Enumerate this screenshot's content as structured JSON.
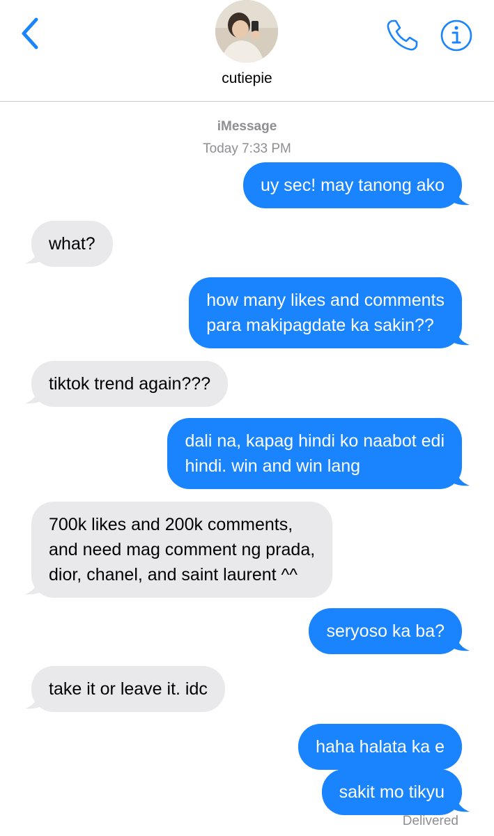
{
  "header": {
    "contact_name": "cutiepie"
  },
  "thread": {
    "service": "iMessage",
    "timestamp": "Today 7:33 PM",
    "messages": [
      {
        "direction": "outgoing",
        "text": "uy sec! may tanong ako"
      },
      {
        "direction": "incoming",
        "text": "what?"
      },
      {
        "direction": "outgoing",
        "text": "how many likes and comments\npara makipagdate  ka sakin??"
      },
      {
        "direction": "incoming",
        "text": "tiktok trend again???"
      },
      {
        "direction": "outgoing",
        "text": "dali na, kapag hindi ko naabot edi\nhindi. win and win lang"
      },
      {
        "direction": "incoming",
        "text": "700k likes and 200k comments,\nand need mag comment ng  prada,\ndior, chanel, and saint laurent ^^"
      },
      {
        "direction": "outgoing",
        "text": "seryoso ka ba?"
      },
      {
        "direction": "incoming",
        "text": "take it or leave it. idc"
      },
      {
        "direction": "outgoing",
        "text": "haha halata ka e"
      },
      {
        "direction": "outgoing",
        "text": "sakit mo tikyu"
      }
    ],
    "status": "Delivered"
  },
  "colors": {
    "accent": "#1a84ff",
    "incoming_bubble": "#e9e9eb",
    "secondary_text": "#8e8e93"
  }
}
